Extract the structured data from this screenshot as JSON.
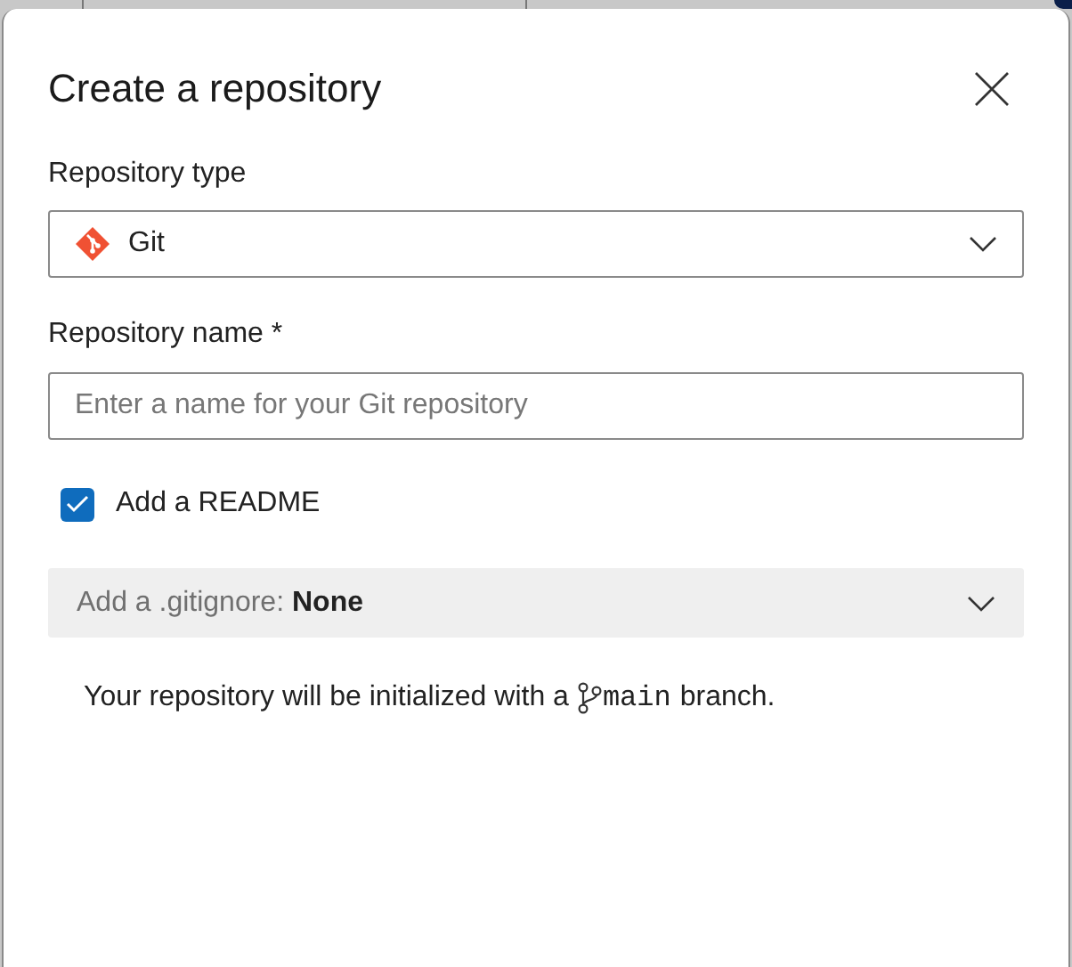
{
  "dialog": {
    "title": "Create a repository"
  },
  "repository_type": {
    "label": "Repository type",
    "value": "Git"
  },
  "repository_name": {
    "label": "Repository name *",
    "placeholder": "Enter a name for your Git repository"
  },
  "readme": {
    "label": "Add a README",
    "checked": true
  },
  "gitignore": {
    "label": "Add a .gitignore:",
    "value": "None"
  },
  "info": {
    "prefix": "Your repository will be initialized with a",
    "branch": "main",
    "suffix": "branch."
  }
}
